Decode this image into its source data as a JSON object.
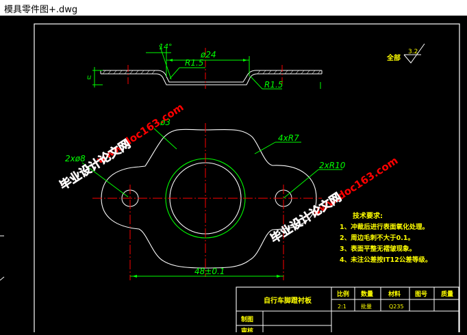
{
  "window": {
    "title": "模具零件图+.dwg"
  },
  "drawing": {
    "dims": {
      "angle": "14°",
      "dia_top": "ø24",
      "r_top": "R1.5",
      "r_side": "R1.5",
      "left_v": "u",
      "dia_center": "ø3",
      "holes": "2xø8",
      "r7": "4xR7",
      "r10": "2xR10",
      "width": "48±0.1"
    },
    "roughness": {
      "label": "全部",
      "value": "3.2"
    },
    "tech": {
      "title": "技术要求:",
      "items": [
        "1、冲裁后进行表面氧化处理。",
        "2、周边毛刺不大于0.1。",
        "3、表面平整无褶皱现象。",
        "4、未注公差按IT12公差等级。"
      ]
    },
    "titleblock": {
      "part_name": "自行车脚蹬衬板",
      "headers": [
        "比例",
        "数量",
        "材料",
        "图号",
        "质量"
      ],
      "values": [
        "2:1",
        "批量",
        "Q235"
      ],
      "rows": [
        "制图",
        "审核"
      ]
    },
    "watermarks": [
      "www.doc163.com",
      "毕业设计论文网"
    ]
  },
  "colors": {
    "cad_white": "#ffffff",
    "cad_green": "#00ff00",
    "cad_red": "#ff0000",
    "cad_yellow": "#ffff00",
    "watermark_red": "#ff0000"
  }
}
